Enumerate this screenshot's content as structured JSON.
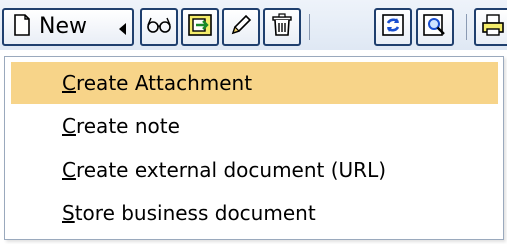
{
  "toolbar": {
    "new_button": {
      "label": "New",
      "icon": "new-document-icon"
    },
    "buttons": [
      {
        "icon": "glasses-icon"
      },
      {
        "icon": "export-icon"
      },
      {
        "icon": "pencil-icon"
      },
      {
        "icon": "trash-icon"
      },
      {
        "icon": "refresh-icon"
      },
      {
        "icon": "search-document-icon"
      },
      {
        "icon": "print-icon"
      }
    ]
  },
  "menu": {
    "items": [
      {
        "key": "C",
        "rest": "reate Attachment",
        "label": "Create Attachment",
        "highlighted": true
      },
      {
        "key": "C",
        "rest": "reate note",
        "label": "Create note",
        "highlighted": false
      },
      {
        "key": "C",
        "rest": "reate external document (URL)",
        "label": "Create external document (URL)",
        "highlighted": false
      },
      {
        "key": "S",
        "rest": "tore business document",
        "label": "Store business document",
        "highlighted": false
      }
    ]
  },
  "colors": {
    "highlight": "#f7d489",
    "button_border": "#1f3f6e",
    "toolbar_bg": "#e6edf7"
  }
}
